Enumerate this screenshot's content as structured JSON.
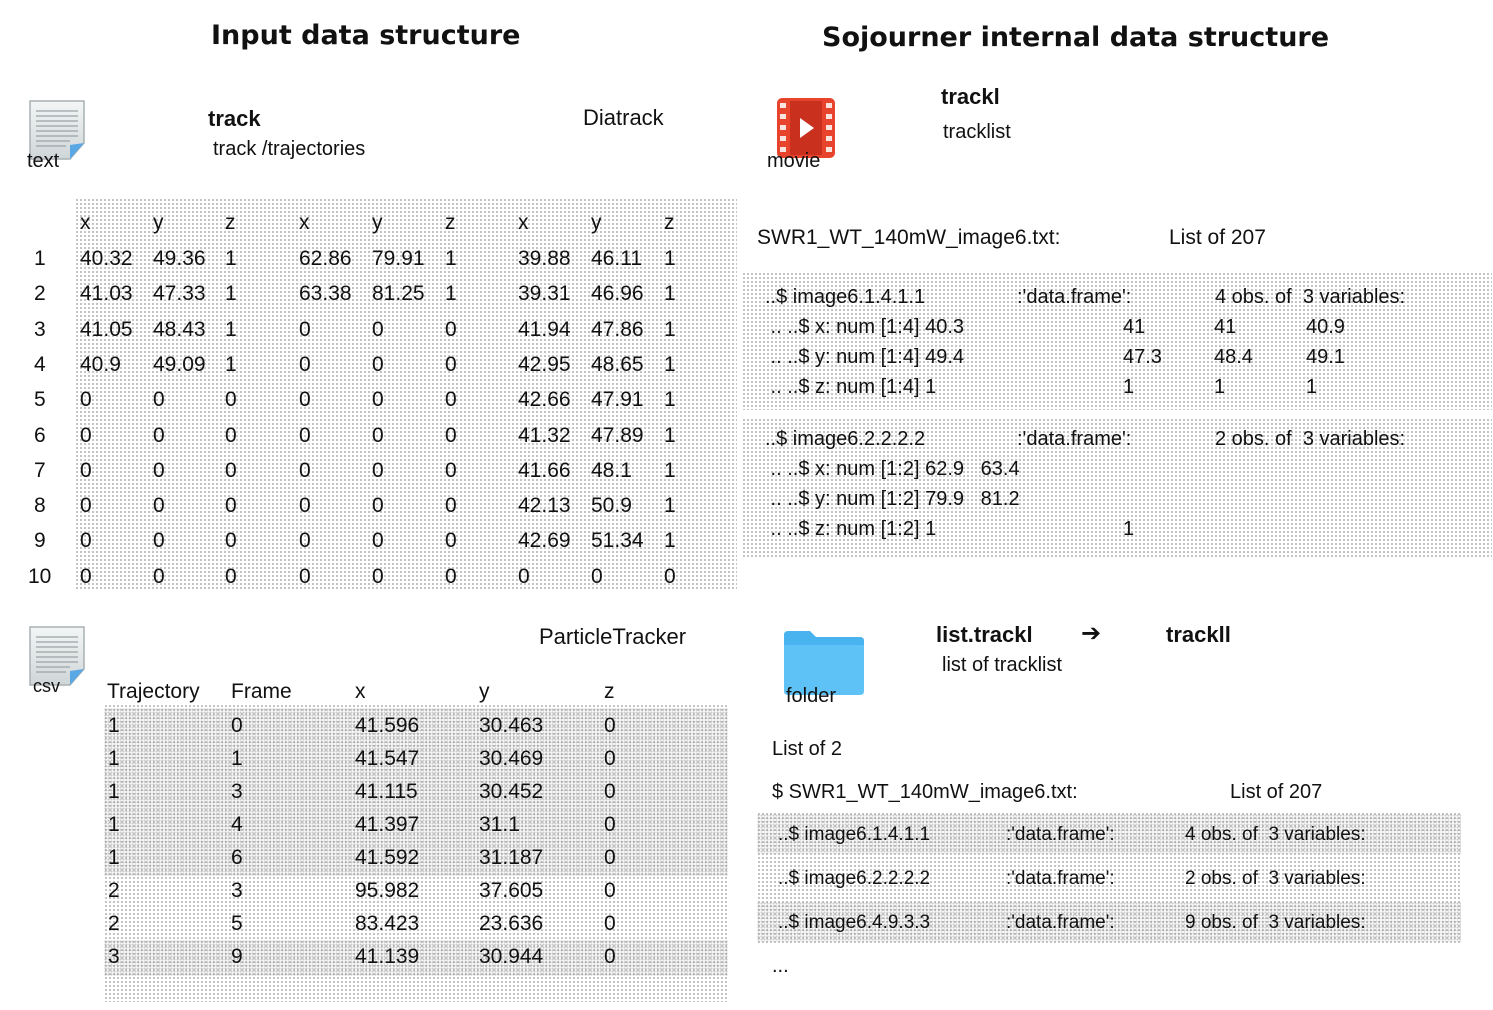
{
  "titles": {
    "input": "Input data structure",
    "internal": "Sojourner internal data structure"
  },
  "icons": {
    "text_label": "text",
    "csv_label": "csv",
    "movie_label": "movie",
    "folder_label": "folder"
  },
  "diatrack": {
    "track_label": "track",
    "track_sub": "track /trajectories",
    "format": "Diatrack",
    "headers": [
      "x",
      "y",
      "z",
      "x",
      "y",
      "z",
      "x",
      "y",
      "z"
    ],
    "rows": [
      [
        "1",
        "40.32",
        "49.36",
        "1",
        "62.86",
        "79.91",
        "1",
        "39.88",
        "46.11",
        "1"
      ],
      [
        "2",
        "41.03",
        "47.33",
        "1",
        "63.38",
        "81.25",
        "1",
        "39.31",
        "46.96",
        "1"
      ],
      [
        "3",
        "41.05",
        "48.43",
        "1",
        "0",
        "0",
        "0",
        "41.94",
        "47.86",
        "1"
      ],
      [
        "4",
        "40.9",
        "49.09",
        "1",
        "0",
        "0",
        "0",
        "42.95",
        "48.65",
        "1"
      ],
      [
        "5",
        "0",
        "0",
        "0",
        "0",
        "0",
        "0",
        "42.66",
        "47.91",
        "1"
      ],
      [
        "6",
        "0",
        "0",
        "0",
        "0",
        "0",
        "0",
        "41.32",
        "47.89",
        "1"
      ],
      [
        "7",
        "0",
        "0",
        "0",
        "0",
        "0",
        "0",
        "41.66",
        "48.1",
        "1"
      ],
      [
        "8",
        "0",
        "0",
        "0",
        "0",
        "0",
        "0",
        "42.13",
        "50.9",
        "1"
      ],
      [
        "9",
        "0",
        "0",
        "0",
        "0",
        "0",
        "0",
        "42.69",
        "51.34",
        "1"
      ],
      [
        "10",
        "0",
        "0",
        "0",
        "0",
        "0",
        "0",
        "0",
        "0",
        "0"
      ]
    ]
  },
  "particletracker": {
    "format": "ParticleTracker",
    "headers": [
      "Trajectory",
      "Frame",
      "x",
      "y",
      "z"
    ],
    "rows": [
      [
        "1",
        "0",
        "41.596",
        "30.463",
        "0"
      ],
      [
        "1",
        "1",
        "41.547",
        "30.469",
        "0"
      ],
      [
        "1",
        "3",
        "41.115",
        "30.452",
        "0"
      ],
      [
        "1",
        "4",
        "41.397",
        "31.1",
        "0"
      ],
      [
        "1",
        "6",
        "41.592",
        "31.187",
        "0"
      ],
      [
        "2",
        "3",
        "95.982",
        "37.605",
        "0"
      ],
      [
        "2",
        "5",
        "83.423",
        "23.636",
        "0"
      ],
      [
        "3",
        "9",
        "41.139",
        "30.944",
        "0"
      ]
    ]
  },
  "trackl": {
    "name": "trackl",
    "sub": "tracklist",
    "file": "SWR1_WT_140mW_image6.txt:",
    "list_of": "List of 207",
    "block1": [
      [
        "..$ image6.1.4.1.1",
        ":'data.frame':",
        "4 obs. of  3 variables:",
        ""
      ],
      [
        " .. ..$ x: num [1:4] 40.3",
        "41",
        "41",
        "40.9"
      ],
      [
        " .. ..$ y: num [1:4] 49.4",
        "47.3",
        "48.4",
        "49.1"
      ],
      [
        " .. ..$ z: num [1:4] 1",
        "1",
        "1",
        "1"
      ]
    ],
    "block2": [
      [
        "..$ image6.2.2.2.2",
        ":'data.frame':",
        "2 obs. of  3 variables:"
      ],
      [
        " .. ..$ x: num [1:2] 62.9   63.4"
      ],
      [
        " .. ..$ y: num [1:2] 79.9   81.2"
      ],
      [
        " .. ..$ z: num [1:2] 1",
        "1"
      ]
    ]
  },
  "trackll": {
    "from": "list.trackl",
    "arrow": "➔",
    "to": "trackll",
    "sub": "list of tracklist",
    "list_of": "List of 2",
    "file": "$ SWR1_WT_140mW_image6.txt:",
    "file_list_of": "List of 207",
    "entries": [
      [
        "..$ image6.1.4.1.1",
        ":'data.frame':",
        "4 obs. of  3 variables:"
      ],
      [
        "..$ image6.2.2.2.2",
        ":'data.frame':",
        "2 obs. of  3 variables:"
      ],
      [
        "..$ image6.4.9.3.3",
        ":'data.frame':",
        "9 obs. of  3 variables:"
      ]
    ],
    "ellipsis": "..."
  }
}
